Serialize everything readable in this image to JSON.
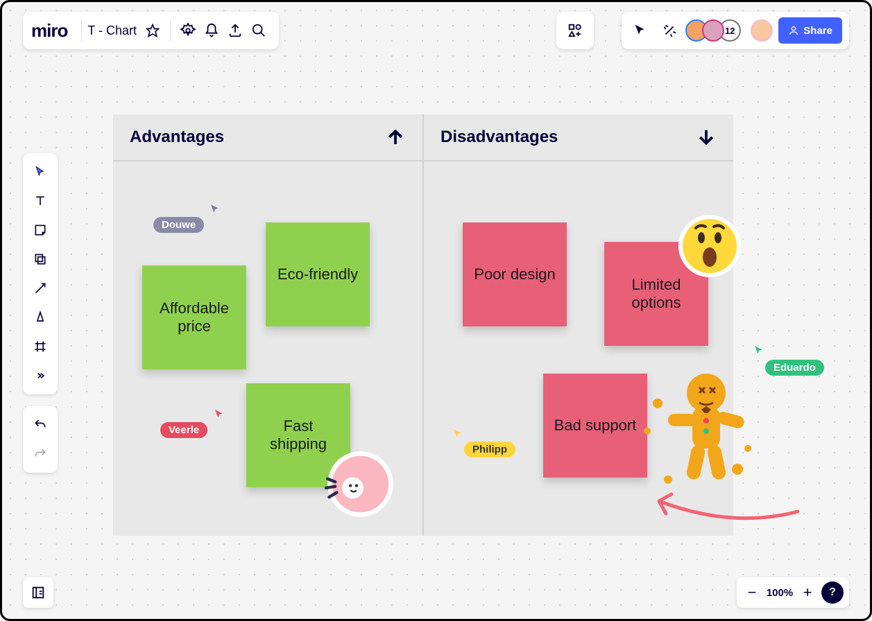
{
  "header": {
    "logo": "miro",
    "board_title": "T - Chart"
  },
  "presence": {
    "count_overflow": "12",
    "share_label": "Share"
  },
  "tchart": {
    "left_title": "Advantages",
    "right_title": "Disadvantages"
  },
  "stickies": {
    "affordable": "Affordable price",
    "eco": "Eco-friendly",
    "fast": "Fast shipping",
    "poor": "Poor design",
    "limited": "Limited options",
    "bad": "Bad support"
  },
  "cursors": {
    "douwe": "Douwe",
    "veerle": "Veerle",
    "philipp": "Philipp",
    "eduardo": "Eduardo"
  },
  "zoom": {
    "value": "100%"
  },
  "help": "?"
}
